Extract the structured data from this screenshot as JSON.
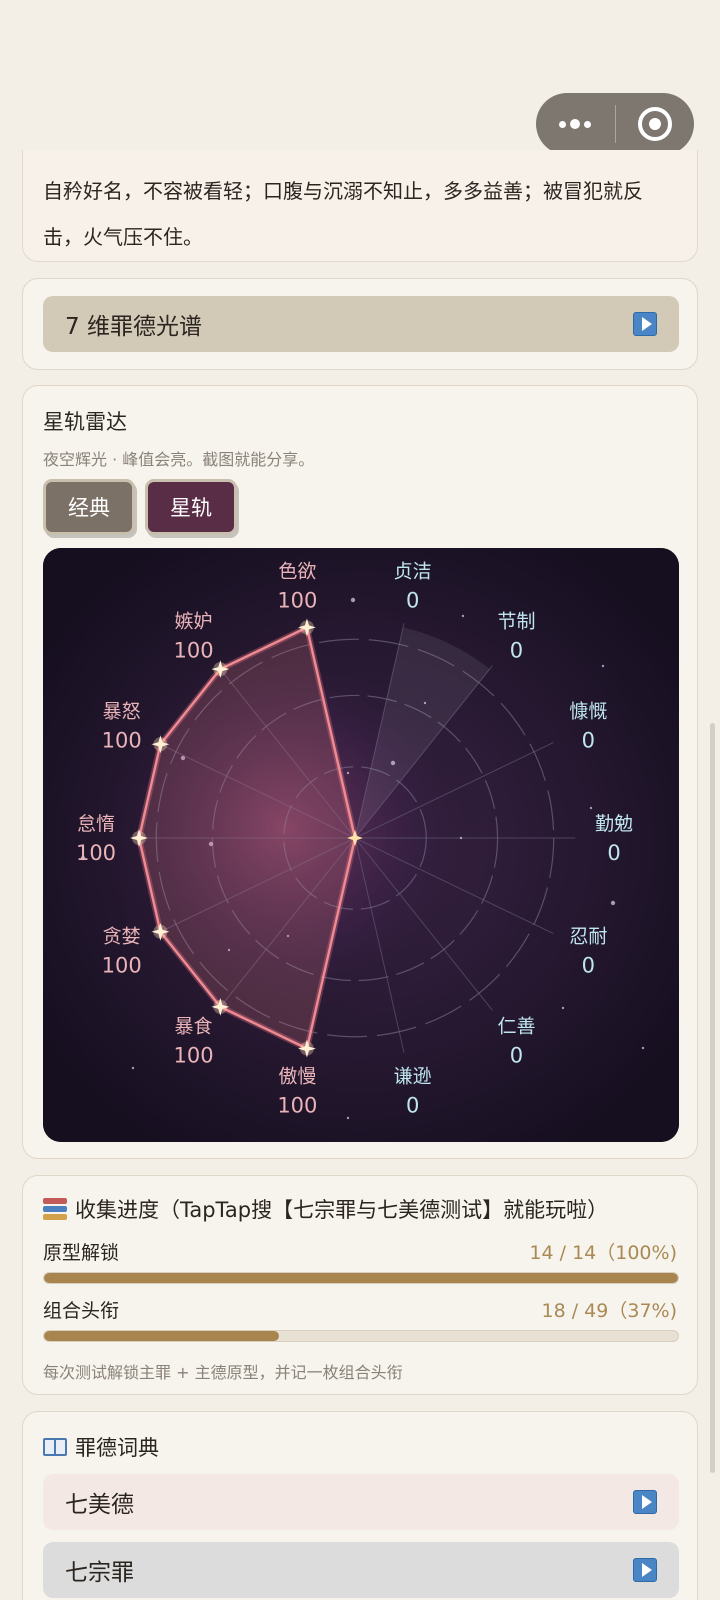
{
  "summary": {
    "text": "自矜好名，不容被看轻；口腹与沉溺不知止，多多益善；被冒犯就反击，火气压不住。"
  },
  "spectrum": {
    "label": "7 维罪德光谱"
  },
  "radar_section": {
    "title": "星轨雷达",
    "subtitle": "夜空辉光 · 峰值会亮。截图就能分享。",
    "buttons": {
      "classic": "经典",
      "star": "星轨"
    }
  },
  "chart_data": {
    "type": "radar",
    "max": 100,
    "axes": [
      {
        "label": "色欲",
        "value": 100,
        "kind": "sin"
      },
      {
        "label": "贞洁",
        "value": 0,
        "kind": "virtue"
      },
      {
        "label": "节制",
        "value": 0,
        "kind": "virtue"
      },
      {
        "label": "慷慨",
        "value": 0,
        "kind": "virtue"
      },
      {
        "label": "勤勉",
        "value": 0,
        "kind": "virtue"
      },
      {
        "label": "忍耐",
        "value": 0,
        "kind": "virtue"
      },
      {
        "label": "仁善",
        "value": 0,
        "kind": "virtue"
      },
      {
        "label": "谦逊",
        "value": 0,
        "kind": "virtue"
      },
      {
        "label": "傲慢",
        "value": 100,
        "kind": "sin"
      },
      {
        "label": "暴食",
        "value": 100,
        "kind": "sin"
      },
      {
        "label": "贪婪",
        "value": 100,
        "kind": "sin"
      },
      {
        "label": "怠惰",
        "value": 100,
        "kind": "sin"
      },
      {
        "label": "暴怒",
        "value": 100,
        "kind": "sin"
      },
      {
        "label": "嫉妒",
        "value": 100,
        "kind": "sin"
      }
    ],
    "colors": {
      "sin": "#e9b3b8",
      "virtue": "#bfe6ef",
      "line": "#e0707c"
    }
  },
  "collection": {
    "title": "收集进度（TapTap搜【七宗罪与七美德测试】就能玩啦）",
    "rows": [
      {
        "label": "原型解锁",
        "value": "14 / 14（100%)",
        "progress": 1.0
      },
      {
        "label": "组合头衔",
        "value": "18 / 49（37%)",
        "progress": 0.37
      }
    ],
    "note": "每次测试解锁主罪 + 主德原型，并记一枚组合头衔"
  },
  "dictionary": {
    "title": "罪德词典",
    "items": [
      "七美德",
      "七宗罪"
    ]
  }
}
